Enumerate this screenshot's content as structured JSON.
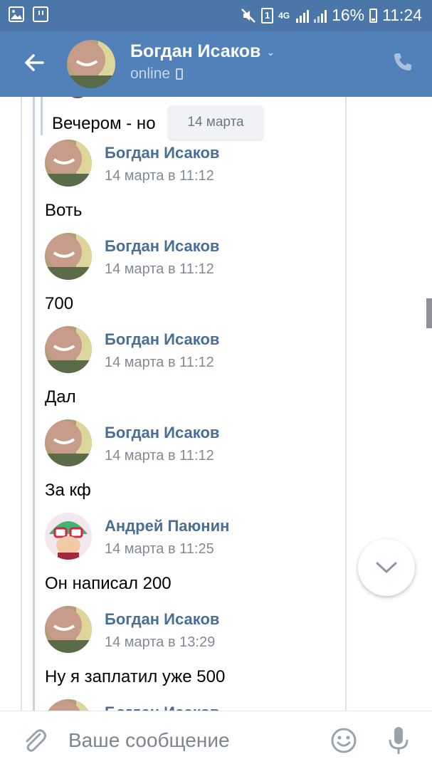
{
  "status_bar": {
    "time": "11:24",
    "battery": "16%",
    "network": "4G",
    "sim": "1"
  },
  "header": {
    "title": "Богдан Исаков",
    "status": "online"
  },
  "chat": {
    "date_pill": "14 марта",
    "first_text": "Вечером - но",
    "messages": [
      {
        "author": "Богдан Исаков",
        "time": "14 марта в 11:12",
        "text": "Воть",
        "avatar": "bogdan"
      },
      {
        "author": "Богдан Исаков",
        "time": "14 марта в 11:12",
        "text": "700",
        "avatar": "bogdan"
      },
      {
        "author": "Богдан Исаков",
        "time": "14 марта в 11:12",
        "text": "Дал",
        "avatar": "bogdan"
      },
      {
        "author": "Богдан Исаков",
        "time": "14 марта в 11:12",
        "text": "За кф",
        "avatar": "bogdan"
      },
      {
        "author": "Андрей Паюнин",
        "time": "14 марта в 11:25",
        "text": "Он написал 200",
        "avatar": "andrey"
      },
      {
        "author": "Богдан Исаков",
        "time": "14 марта в 13:29",
        "text": "Ну я заплатил уже 500",
        "avatar": "bogdan"
      },
      {
        "author": "Богдан Исаков",
        "time": "",
        "text": "",
        "avatar": "bogdan"
      }
    ]
  },
  "composer": {
    "placeholder": "Ваше сообщение"
  },
  "colors": {
    "status_bar": "#4a76a8",
    "app_bar": "#5181b8",
    "author_name": "#4a6e96",
    "timestamp": "#828a94"
  },
  "icons": {
    "back": "arrow-left-icon",
    "call": "phone-icon",
    "attach": "paperclip-icon",
    "emoji": "smile-icon",
    "mic": "microphone-icon",
    "scroll_down": "chevron-down-icon"
  }
}
